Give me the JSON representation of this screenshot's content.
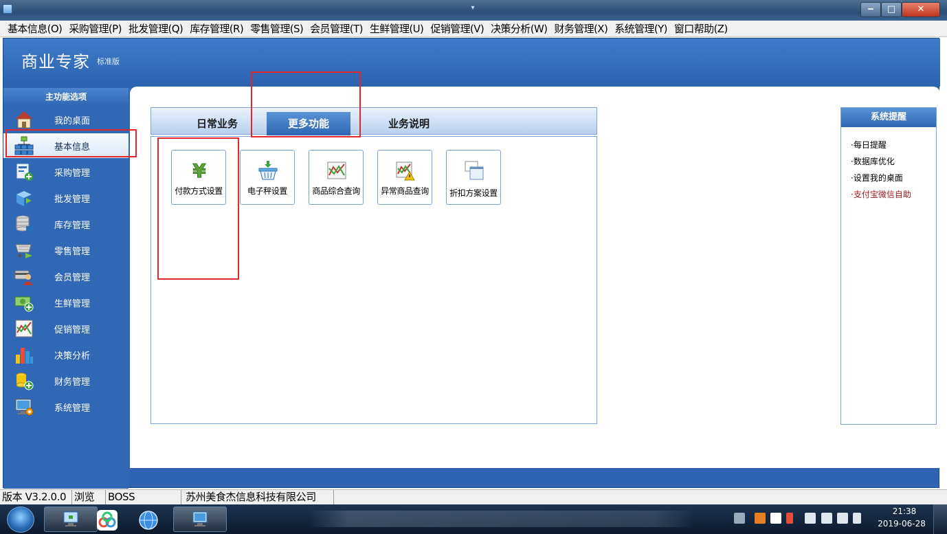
{
  "menu": [
    "基本信息(O)",
    "采购管理(P)",
    "批发管理(Q)",
    "库存管理(R)",
    "零售管理(S)",
    "会员管理(T)",
    "生鲜管理(U)",
    "促销管理(V)",
    "决策分析(W)",
    "财务管理(X)",
    "系统管理(Y)",
    "窗口帮助(Z)"
  ],
  "brand": {
    "title": "商业专家",
    "edition": "标准版"
  },
  "sidebar": {
    "header": "主功能选项",
    "items": [
      {
        "label": "我的桌面",
        "icon": "house-icon"
      },
      {
        "label": "基本信息",
        "icon": "org-chart-icon",
        "active": true
      },
      {
        "label": "采购管理",
        "icon": "purchase-doc-icon"
      },
      {
        "label": "批发管理",
        "icon": "wholesale-box-icon"
      },
      {
        "label": "库存管理",
        "icon": "database-icon"
      },
      {
        "label": "零售管理",
        "icon": "shopping-cart-icon"
      },
      {
        "label": "会员管理",
        "icon": "member-card-icon"
      },
      {
        "label": "生鲜管理",
        "icon": "cash-add-icon"
      },
      {
        "label": "促销管理",
        "icon": "line-chart-icon"
      },
      {
        "label": "决策分析",
        "icon": "bar-chart-icon"
      },
      {
        "label": "财务管理",
        "icon": "coins-icon"
      },
      {
        "label": "系统管理",
        "icon": "computer-settings-icon"
      }
    ]
  },
  "tabs": [
    {
      "label": "日常业务",
      "active": false
    },
    {
      "label": "更多功能",
      "active": true
    },
    {
      "label": "业务说明",
      "active": false
    }
  ],
  "functions": [
    {
      "label": "付款方式设置",
      "icon": "yen-icon"
    },
    {
      "label": "电子秤设置",
      "icon": "scale-basket-icon"
    },
    {
      "label": "商品综合查询",
      "icon": "product-chart-icon"
    },
    {
      "label": "异常商品查询",
      "icon": "warning-chart-icon"
    },
    {
      "label": "折扣方案设置",
      "icon": "window-icon"
    }
  ],
  "reminder": {
    "header": "系统提醒",
    "items": [
      "·每日提醒",
      "·数据库优化",
      "·设置我的桌面",
      "·支付宝微信自助"
    ]
  },
  "status": {
    "version": "版本 V3.2.0.0",
    "mode": "浏览",
    "user": "BOSS",
    "company": "苏州美食杰信息科技有限公司"
  },
  "clock": {
    "time": "21:38",
    "date": "2019-06-28"
  },
  "colors": {
    "accent": "#2f64b0",
    "highlight": "#e3262a",
    "alert_text": "#9c1b1b"
  }
}
